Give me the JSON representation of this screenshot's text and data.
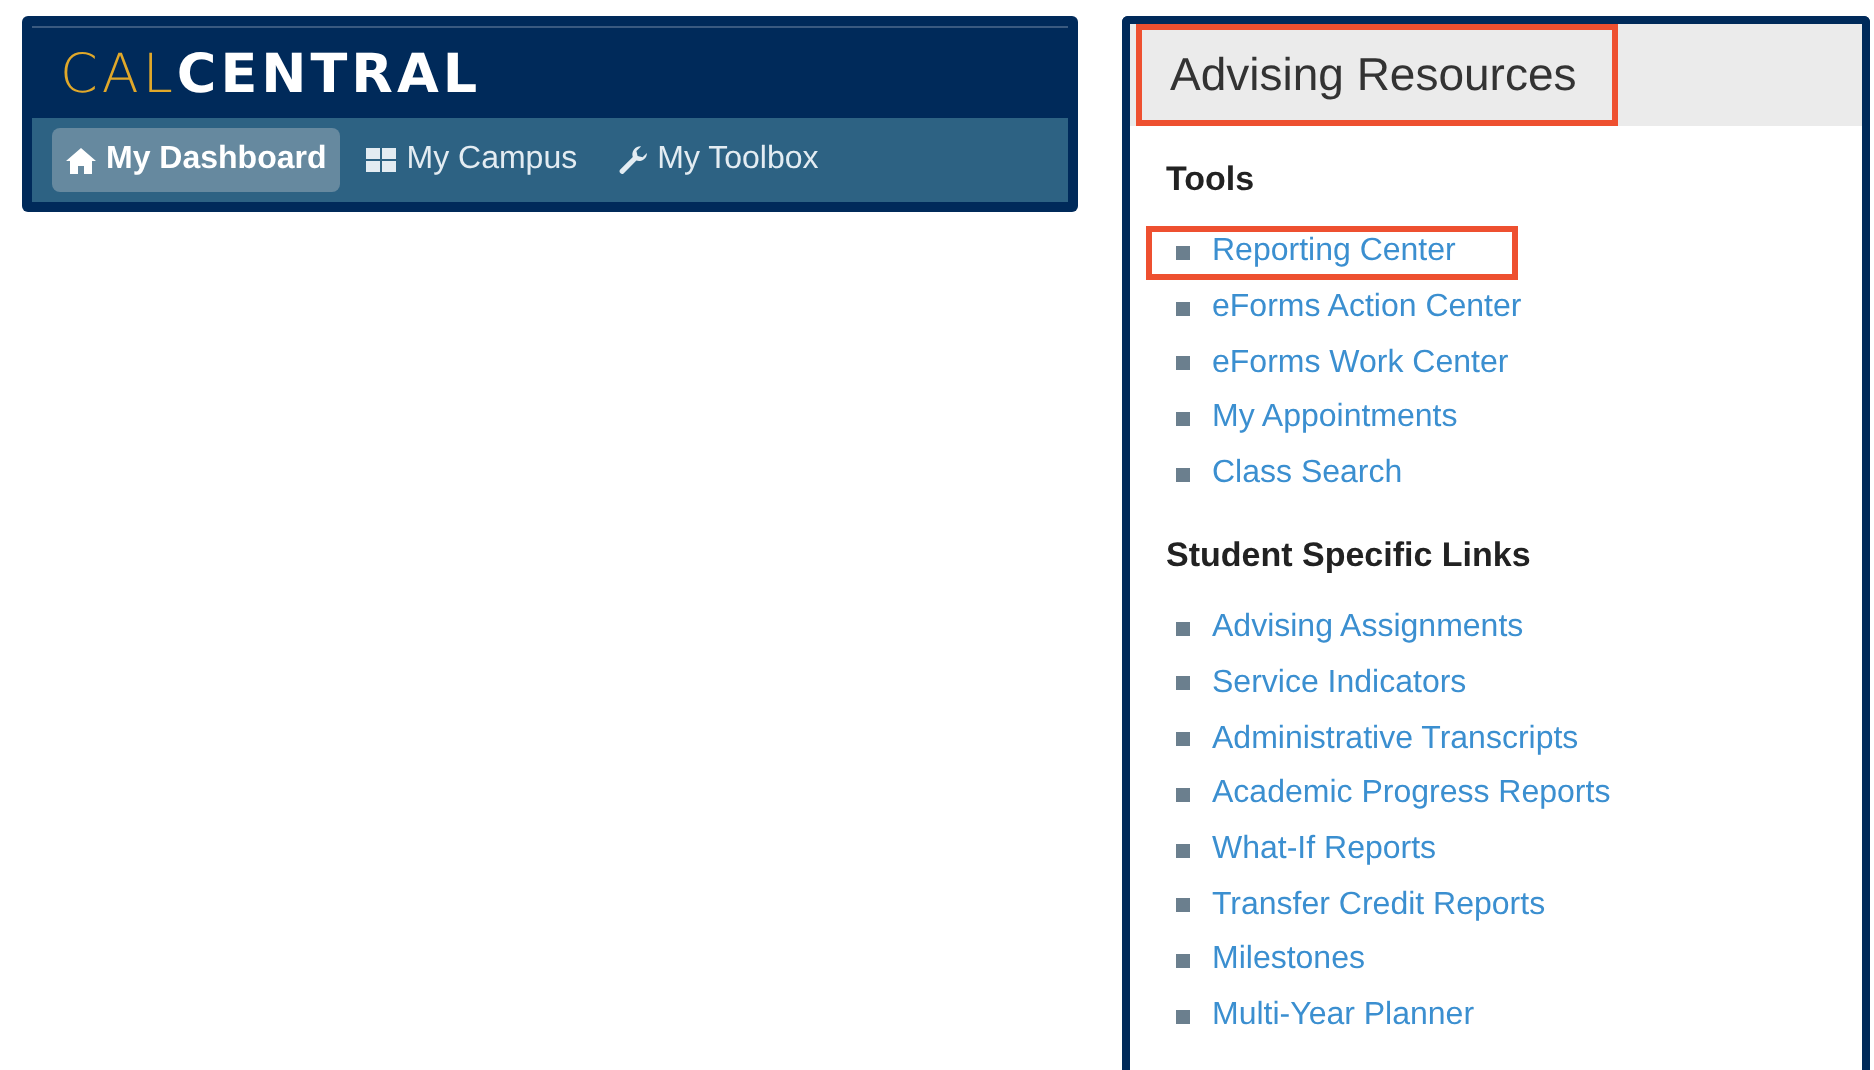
{
  "header": {
    "logo": {
      "accent": "CAL",
      "rest": "CENTRAL"
    },
    "nav": [
      {
        "label": "My Dashboard",
        "kind": "home",
        "selected": true
      },
      {
        "label": "My Campus",
        "kind": "grid",
        "selected": false
      },
      {
        "label": "My Toolbox",
        "kind": "wrench",
        "selected": false
      }
    ]
  },
  "panel": {
    "title": "Advising Resources",
    "title_highlighted": true,
    "sections": [
      {
        "heading": "Tools",
        "links": [
          {
            "label": "Reporting Center",
            "highlighted": true
          },
          {
            "label": "eForms Action Center",
            "highlighted": false
          },
          {
            "label": "eForms Work Center",
            "highlighted": false
          },
          {
            "label": "My Appointments",
            "highlighted": false
          },
          {
            "label": "Class Search",
            "highlighted": false
          }
        ]
      },
      {
        "heading": "Student Specific Links",
        "links": [
          {
            "label": "Advising Assignments",
            "highlighted": false
          },
          {
            "label": "Service Indicators",
            "highlighted": false
          },
          {
            "label": "Administrative Transcripts",
            "highlighted": false
          },
          {
            "label": "Academic Progress Reports",
            "highlighted": false
          },
          {
            "label": "What-If Reports",
            "highlighted": false
          },
          {
            "label": "Transfer Credit Reports",
            "highlighted": false
          },
          {
            "label": "Milestones",
            "highlighted": false
          },
          {
            "label": "Multi-Year Planner",
            "highlighted": false
          }
        ]
      }
    ]
  }
}
